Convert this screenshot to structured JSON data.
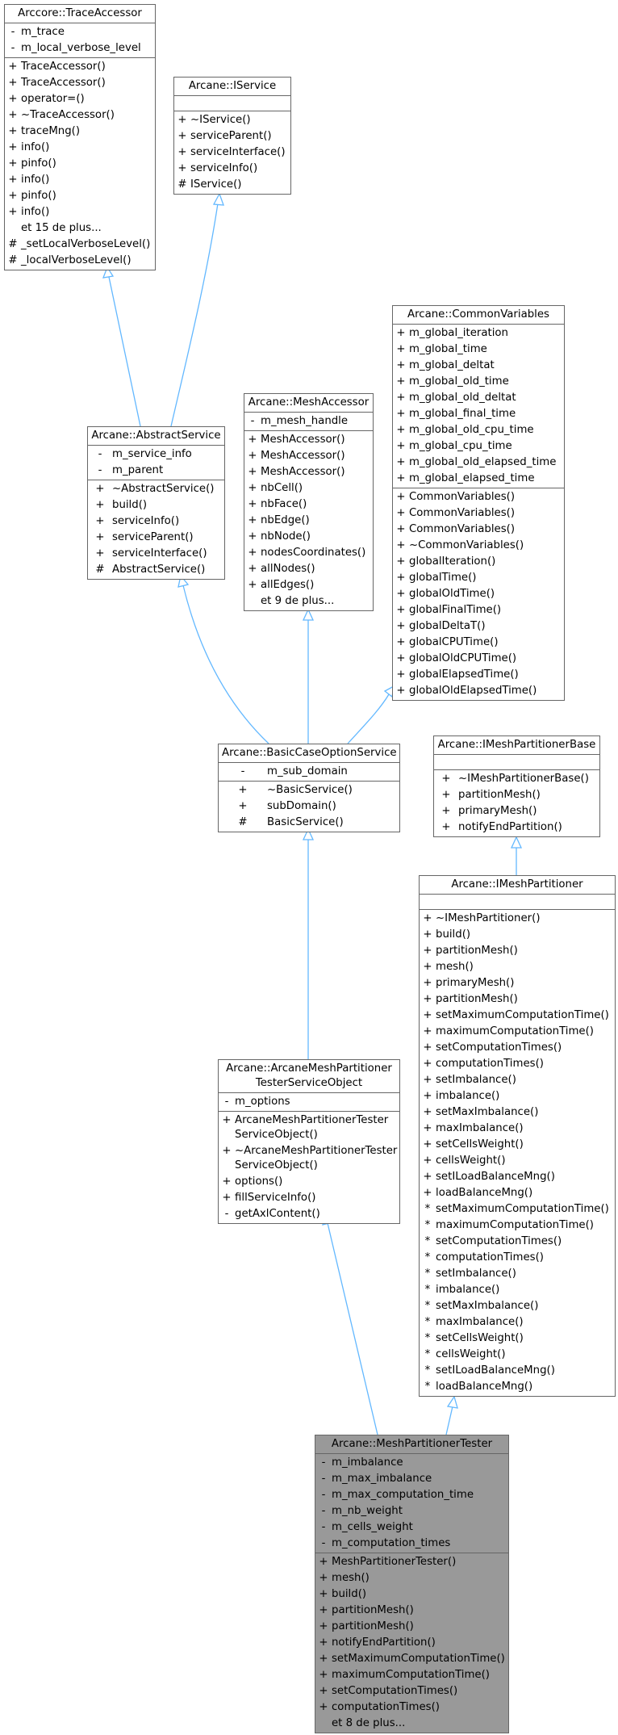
{
  "diagram": {
    "type": "class-inheritance-graph",
    "edge_color": "#63b8ff",
    "current_class_fill": "#999999",
    "classes": [
      {
        "id": "trace-accessor",
        "title": "Arccore::TraceAccessor",
        "attributes": [
          {
            "vis": "-",
            "name": "m_trace"
          },
          {
            "vis": "-",
            "name": "m_local_verbose_level"
          }
        ],
        "methods": [
          {
            "vis": "+",
            "name": "TraceAccessor()"
          },
          {
            "vis": "+",
            "name": "TraceAccessor()"
          },
          {
            "vis": "+",
            "name": "operator=()"
          },
          {
            "vis": "+",
            "name": "~TraceAccessor()"
          },
          {
            "vis": "+",
            "name": "traceMng()"
          },
          {
            "vis": "+",
            "name": "info()"
          },
          {
            "vis": "+",
            "name": "pinfo()"
          },
          {
            "vis": "+",
            "name": "info()"
          },
          {
            "vis": "+",
            "name": "pinfo()"
          },
          {
            "vis": "+",
            "name": "info()"
          },
          {
            "vis": "",
            "name": "et 15 de plus..."
          },
          {
            "vis": "#",
            "name": "_setLocalVerboseLevel()"
          },
          {
            "vis": "#",
            "name": "_localVerboseLevel()"
          }
        ]
      },
      {
        "id": "iservice",
        "title": "Arcane::IService",
        "attributes": [],
        "methods": [
          {
            "vis": "+",
            "name": "~IService()"
          },
          {
            "vis": "+",
            "name": "serviceParent()"
          },
          {
            "vis": "+",
            "name": "serviceInterface()"
          },
          {
            "vis": "+",
            "name": "serviceInfo()"
          },
          {
            "vis": "#",
            "name": "IService()"
          }
        ]
      },
      {
        "id": "abstract-service",
        "title": "Arcane::AbstractService",
        "attributes": [
          {
            "vis": "-",
            "name": "m_service_info"
          },
          {
            "vis": "-",
            "name": "m_parent"
          }
        ],
        "methods": [
          {
            "vis": "+",
            "name": "~AbstractService()"
          },
          {
            "vis": "+",
            "name": "build()"
          },
          {
            "vis": "+",
            "name": "serviceInfo()"
          },
          {
            "vis": "+",
            "name": "serviceParent()"
          },
          {
            "vis": "+",
            "name": "serviceInterface()"
          },
          {
            "vis": "#",
            "name": "AbstractService()"
          }
        ]
      },
      {
        "id": "mesh-accessor",
        "title": "Arcane::MeshAccessor",
        "attributes": [
          {
            "vis": "-",
            "name": "m_mesh_handle"
          }
        ],
        "methods": [
          {
            "vis": "+",
            "name": "MeshAccessor()"
          },
          {
            "vis": "+",
            "name": "MeshAccessor()"
          },
          {
            "vis": "+",
            "name": "MeshAccessor()"
          },
          {
            "vis": "+",
            "name": "nbCell()"
          },
          {
            "vis": "+",
            "name": "nbFace()"
          },
          {
            "vis": "+",
            "name": "nbEdge()"
          },
          {
            "vis": "+",
            "name": "nbNode()"
          },
          {
            "vis": "+",
            "name": "nodesCoordinates()"
          },
          {
            "vis": "+",
            "name": "allNodes()"
          },
          {
            "vis": "+",
            "name": "allEdges()"
          },
          {
            "vis": "",
            "name": "et 9 de plus..."
          }
        ]
      },
      {
        "id": "common-variables",
        "title": "Arcane::CommonVariables",
        "attributes": [
          {
            "vis": "+",
            "name": "m_global_iteration"
          },
          {
            "vis": "+",
            "name": "m_global_time"
          },
          {
            "vis": "+",
            "name": "m_global_deltat"
          },
          {
            "vis": "+",
            "name": "m_global_old_time"
          },
          {
            "vis": "+",
            "name": "m_global_old_deltat"
          },
          {
            "vis": "+",
            "name": "m_global_final_time"
          },
          {
            "vis": "+",
            "name": "m_global_old_cpu_time"
          },
          {
            "vis": "+",
            "name": "m_global_cpu_time"
          },
          {
            "vis": "+",
            "name": "m_global_old_elapsed_time"
          },
          {
            "vis": "+",
            "name": "m_global_elapsed_time"
          }
        ],
        "methods": [
          {
            "vis": "+",
            "name": "CommonVariables()"
          },
          {
            "vis": "+",
            "name": "CommonVariables()"
          },
          {
            "vis": "+",
            "name": "CommonVariables()"
          },
          {
            "vis": "+",
            "name": "~CommonVariables()"
          },
          {
            "vis": "+",
            "name": "globalIteration()"
          },
          {
            "vis": "+",
            "name": "globalTime()"
          },
          {
            "vis": "+",
            "name": "globalOldTime()"
          },
          {
            "vis": "+",
            "name": "globalFinalTime()"
          },
          {
            "vis": "+",
            "name": "globalDeltaT()"
          },
          {
            "vis": "+",
            "name": "globalCPUTime()"
          },
          {
            "vis": "+",
            "name": "globalOldCPUTime()"
          },
          {
            "vis": "+",
            "name": "globalElapsedTime()"
          },
          {
            "vis": "+",
            "name": "globalOldElapsedTime()"
          }
        ]
      },
      {
        "id": "basic-case-option-service",
        "title": "Arcane::BasicCaseOptionService",
        "attributes": [
          {
            "vis": "-",
            "name": "m_sub_domain"
          }
        ],
        "methods": [
          {
            "vis": "+",
            "name": "~BasicService()"
          },
          {
            "vis": "+",
            "name": "subDomain()"
          },
          {
            "vis": "#",
            "name": "BasicService()"
          }
        ]
      },
      {
        "id": "imesh-partitioner-base",
        "title": "Arcane::IMeshPartitionerBase",
        "attributes": [],
        "methods": [
          {
            "vis": "+",
            "name": "~IMeshPartitionerBase()"
          },
          {
            "vis": "+",
            "name": "partitionMesh()"
          },
          {
            "vis": "+",
            "name": "primaryMesh()"
          },
          {
            "vis": "+",
            "name": "notifyEndPartition()"
          }
        ]
      },
      {
        "id": "imesh-partitioner",
        "title": "Arcane::IMeshPartitioner",
        "attributes": [],
        "methods": [
          {
            "vis": "+",
            "name": "~IMeshPartitioner()"
          },
          {
            "vis": "+",
            "name": "build()"
          },
          {
            "vis": "+",
            "name": "partitionMesh()"
          },
          {
            "vis": "+",
            "name": "mesh()"
          },
          {
            "vis": "+",
            "name": "primaryMesh()"
          },
          {
            "vis": "+",
            "name": "partitionMesh()"
          },
          {
            "vis": "+",
            "name": "setMaximumComputationTime()"
          },
          {
            "vis": "+",
            "name": "maximumComputationTime()"
          },
          {
            "vis": "+",
            "name": "setComputationTimes()"
          },
          {
            "vis": "+",
            "name": "computationTimes()"
          },
          {
            "vis": "+",
            "name": "setImbalance()"
          },
          {
            "vis": "+",
            "name": "imbalance()"
          },
          {
            "vis": "+",
            "name": "setMaxImbalance()"
          },
          {
            "vis": "+",
            "name": "maxImbalance()"
          },
          {
            "vis": "+",
            "name": "setCellsWeight()"
          },
          {
            "vis": "+",
            "name": "cellsWeight()"
          },
          {
            "vis": "+",
            "name": "setILoadBalanceMng()"
          },
          {
            "vis": "+",
            "name": "loadBalanceMng()"
          },
          {
            "vis": "*",
            "name": "setMaximumComputationTime()"
          },
          {
            "vis": "*",
            "name": "maximumComputationTime()"
          },
          {
            "vis": "*",
            "name": "setComputationTimes()"
          },
          {
            "vis": "*",
            "name": "computationTimes()"
          },
          {
            "vis": "*",
            "name": "setImbalance()"
          },
          {
            "vis": "*",
            "name": "imbalance()"
          },
          {
            "vis": "*",
            "name": "setMaxImbalance()"
          },
          {
            "vis": "*",
            "name": "maxImbalance()"
          },
          {
            "vis": "*",
            "name": "setCellsWeight()"
          },
          {
            "vis": "*",
            "name": "cellsWeight()"
          },
          {
            "vis": "*",
            "name": "setILoadBalanceMng()"
          },
          {
            "vis": "*",
            "name": "loadBalanceMng()"
          }
        ]
      },
      {
        "id": "arcane-mesh-partitioner-tester-service-object",
        "title": "Arcane::ArcaneMeshPartitioner\nTesterServiceObject",
        "attributes": [
          {
            "vis": "-",
            "name": "m_options"
          }
        ],
        "methods": [
          {
            "vis": "+",
            "name": "ArcaneMeshPartitionerTester\nServiceObject()"
          },
          {
            "vis": "+",
            "name": "~ArcaneMeshPartitionerTester\nServiceObject()"
          },
          {
            "vis": "+",
            "name": "options()"
          },
          {
            "vis": "+",
            "name": "fillServiceInfo()"
          },
          {
            "vis": "-",
            "name": "getAxlContent()"
          }
        ]
      },
      {
        "id": "mesh-partitioner-tester",
        "title": "Arcane::MeshPartitionerTester",
        "current": true,
        "attributes": [
          {
            "vis": "-",
            "name": "m_imbalance"
          },
          {
            "vis": "-",
            "name": "m_max_imbalance"
          },
          {
            "vis": "-",
            "name": "m_max_computation_time"
          },
          {
            "vis": "-",
            "name": "m_nb_weight"
          },
          {
            "vis": "-",
            "name": "m_cells_weight"
          },
          {
            "vis": "-",
            "name": "m_computation_times"
          }
        ],
        "methods": [
          {
            "vis": "+",
            "name": "MeshPartitionerTester()"
          },
          {
            "vis": "+",
            "name": "mesh()"
          },
          {
            "vis": "+",
            "name": "build()"
          },
          {
            "vis": "+",
            "name": "partitionMesh()"
          },
          {
            "vis": "+",
            "name": "partitionMesh()"
          },
          {
            "vis": "+",
            "name": "notifyEndPartition()"
          },
          {
            "vis": "+",
            "name": "setMaximumComputationTime()"
          },
          {
            "vis": "+",
            "name": "maximumComputationTime()"
          },
          {
            "vis": "+",
            "name": "setComputationTimes()"
          },
          {
            "vis": "+",
            "name": "computationTimes()"
          },
          {
            "vis": "",
            "name": "et 8 de plus..."
          }
        ]
      }
    ],
    "inheritance": [
      {
        "from": "abstract-service",
        "to": "trace-accessor"
      },
      {
        "from": "abstract-service",
        "to": "iservice"
      },
      {
        "from": "basic-case-option-service",
        "to": "abstract-service"
      },
      {
        "from": "basic-case-option-service",
        "to": "mesh-accessor"
      },
      {
        "from": "basic-case-option-service",
        "to": "common-variables"
      },
      {
        "from": "imesh-partitioner",
        "to": "imesh-partitioner-base"
      },
      {
        "from": "arcane-mesh-partitioner-tester-service-object",
        "to": "basic-case-option-service"
      },
      {
        "from": "mesh-partitioner-tester",
        "to": "arcane-mesh-partitioner-tester-service-object"
      },
      {
        "from": "mesh-partitioner-tester",
        "to": "imesh-partitioner"
      }
    ]
  }
}
